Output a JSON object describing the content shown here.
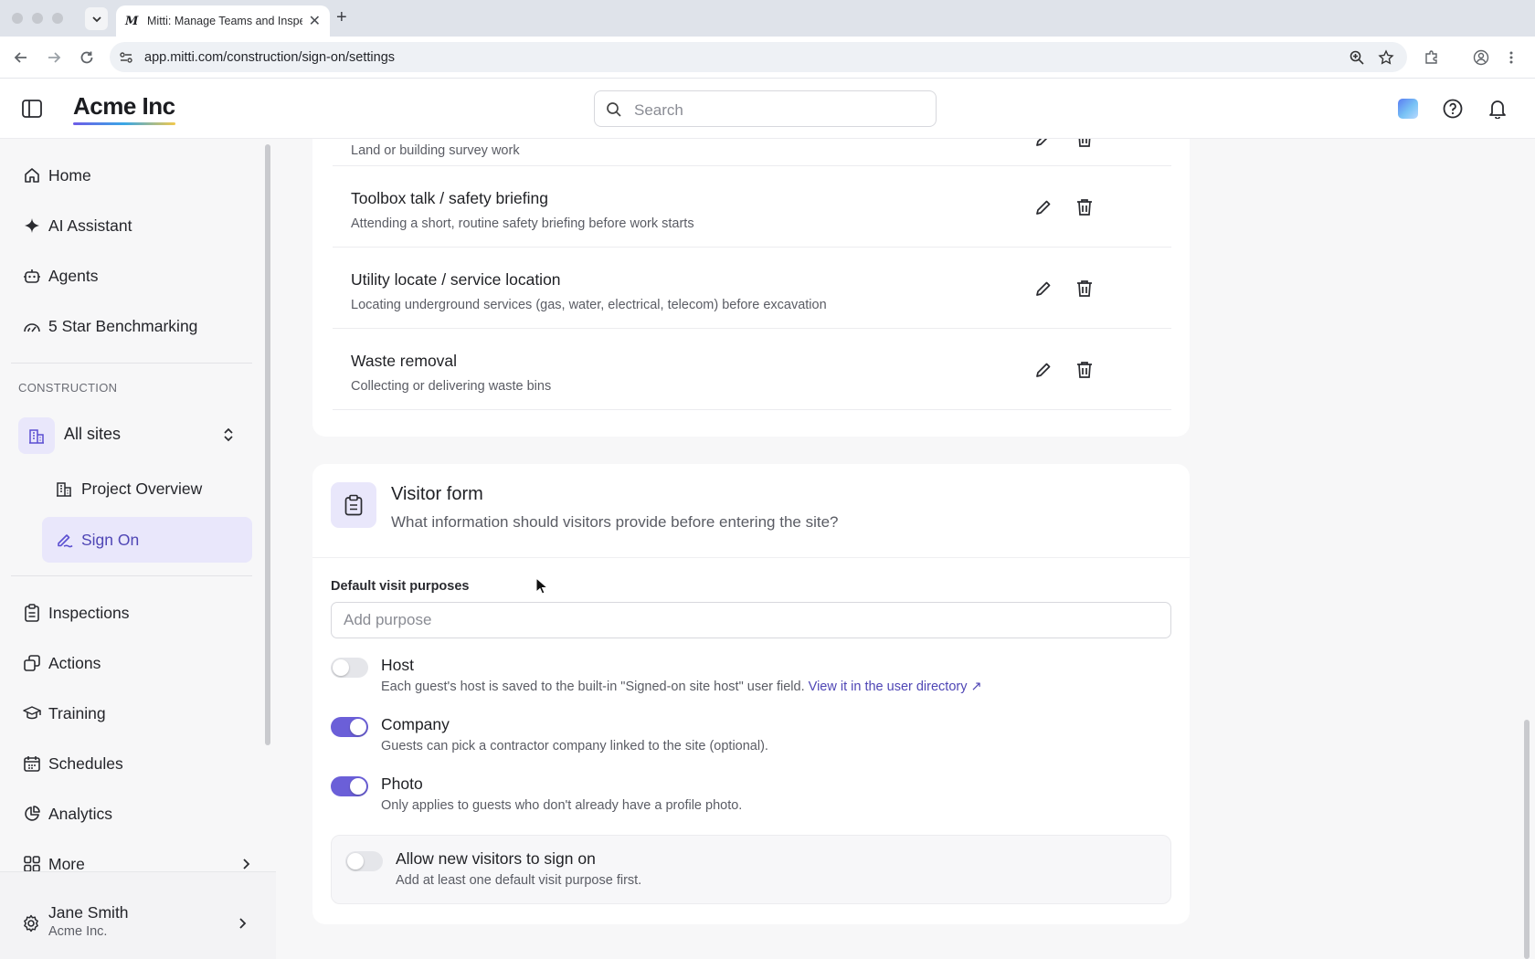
{
  "browser": {
    "tab_favicon": "M",
    "tab_title": "Mitti: Manage Teams and Inspections",
    "url": "app.mitti.com/construction/sign-on/settings",
    "icons": [
      "chevron-down-icon",
      "close-icon",
      "plus-icon",
      "back-icon",
      "forward-icon",
      "reload-icon",
      "site-settings-icon",
      "zoom-icon",
      "star-icon",
      "extensions-icon",
      "profile-icon",
      "kebab-icon"
    ]
  },
  "header": {
    "logo": "Acme Inc",
    "search_placeholder": "Search",
    "icons": [
      "sidebar-toggle-icon",
      "search-icon",
      "ai-gem-icon",
      "help-icon",
      "bell-icon"
    ]
  },
  "sidebar": {
    "top_items": [
      {
        "label": "Home",
        "icon": "home-icon"
      },
      {
        "label": "AI Assistant",
        "icon": "sparkle-icon"
      },
      {
        "label": "Agents",
        "icon": "robot-icon"
      },
      {
        "label": "5 Star Benchmarking",
        "icon": "gauge-icon"
      }
    ],
    "section_label": "CONSTRUCTION",
    "site_selector": "All sites",
    "sub_items": [
      {
        "label": "Project Overview",
        "icon": "building-icon",
        "active": false
      },
      {
        "label": "Sign On",
        "icon": "signature-icon",
        "active": true
      }
    ],
    "bottom_items": [
      {
        "label": "Inspections",
        "icon": "clipboard-icon"
      },
      {
        "label": "Actions",
        "icon": "actions-icon"
      },
      {
        "label": "Training",
        "icon": "graduation-cap-icon"
      },
      {
        "label": "Schedules",
        "icon": "calendar-icon"
      },
      {
        "label": "Analytics",
        "icon": "pie-chart-icon"
      },
      {
        "label": "More",
        "icon": "grid-icon"
      }
    ],
    "user": {
      "name": "Jane Smith",
      "org": "Acme Inc."
    }
  },
  "purposes_list": [
    {
      "title": "",
      "desc": "Land or building survey work"
    },
    {
      "title": "Toolbox talk / safety briefing",
      "desc": "Attending a short, routine safety briefing before work starts"
    },
    {
      "title": "Utility locate / service location",
      "desc": "Locating underground services (gas, water, electrical, telecom) before excavation"
    },
    {
      "title": "Waste removal",
      "desc": "Collecting or delivering waste bins"
    }
  ],
  "visitor_form": {
    "title": "Visitor form",
    "subtitle": "What information should visitors provide before entering the site?",
    "field_label": "Default visit purposes",
    "input_placeholder": "Add purpose",
    "input_value": "",
    "options": [
      {
        "title": "Host",
        "desc": "Each guest's host is saved to the built-in \"Signed-on site host\" user field.",
        "link": "View it in the user directory ↗",
        "enabled": false
      },
      {
        "title": "Company",
        "desc": "Guests can pick a contractor company linked to the site (optional).",
        "enabled": true
      },
      {
        "title": "Photo",
        "desc": "Only applies to guests who don't already have a profile photo.",
        "enabled": true
      }
    ],
    "allow": {
      "title": "Allow new visitors to sign on",
      "desc": "Add at least one default visit purpose first.",
      "enabled": false
    }
  },
  "colors": {
    "accent": "#6b5fd8",
    "accent_bg": "#e9e7fb",
    "link": "#4f46b5"
  }
}
